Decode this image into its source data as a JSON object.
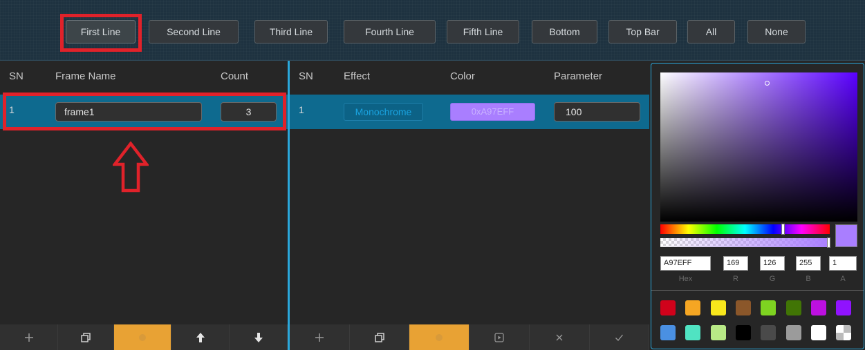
{
  "toolbar": {
    "buttons": [
      {
        "label": "First Line"
      },
      {
        "label": "Second Line"
      },
      {
        "label": "Third Line"
      },
      {
        "label": "Fourth Line"
      },
      {
        "label": "Fifth Line"
      },
      {
        "label": "Bottom"
      },
      {
        "label": "Top Bar"
      },
      {
        "label": "All"
      },
      {
        "label": "None"
      }
    ]
  },
  "frames": {
    "headers": {
      "sn": "SN",
      "name": "Frame Name",
      "count": "Count"
    },
    "rows": [
      {
        "sn": "1",
        "name": "frame1",
        "count": "3"
      }
    ],
    "bottom_icons": [
      "plus-icon",
      "copy-icon",
      "delete-icon",
      "arrow-up-icon",
      "arrow-down-icon"
    ]
  },
  "effects": {
    "headers": {
      "sn": "SN",
      "effect": "Effect",
      "color": "Color",
      "parameter": "Parameter"
    },
    "rows": [
      {
        "sn": "1",
        "effect": "Monochrome",
        "color": "0xA97EFF",
        "parameter": "100"
      }
    ],
    "bottom_icons": [
      "plus-icon",
      "copy-icon",
      "delete-icon",
      "play-icon",
      "close-icon",
      "check-icon"
    ]
  },
  "color_picker": {
    "hex": "A97EFF",
    "r": "169",
    "g": "126",
    "b": "255",
    "a": "1",
    "labels": {
      "hex": "Hex",
      "r": "R",
      "g": "G",
      "b": "B",
      "a": "A"
    },
    "selected_color": "#a97eff",
    "swatches": [
      "#d0021b",
      "#f5a623",
      "#f8e71c",
      "#8b572a",
      "#7ed321",
      "#417505",
      "#bd10e0",
      "#9013fe",
      "#4a90e2",
      "#50e3c2",
      "#b8e986",
      "#000000",
      "#4a4a4a",
      "#9b9b9b",
      "#ffffff",
      "transparent"
    ]
  },
  "colors": {
    "accent_blue": "#2aa8dc",
    "selected_row": "#0e6a8f",
    "delete_orange": "#e8a234",
    "annotation_red": "#e0222a"
  }
}
